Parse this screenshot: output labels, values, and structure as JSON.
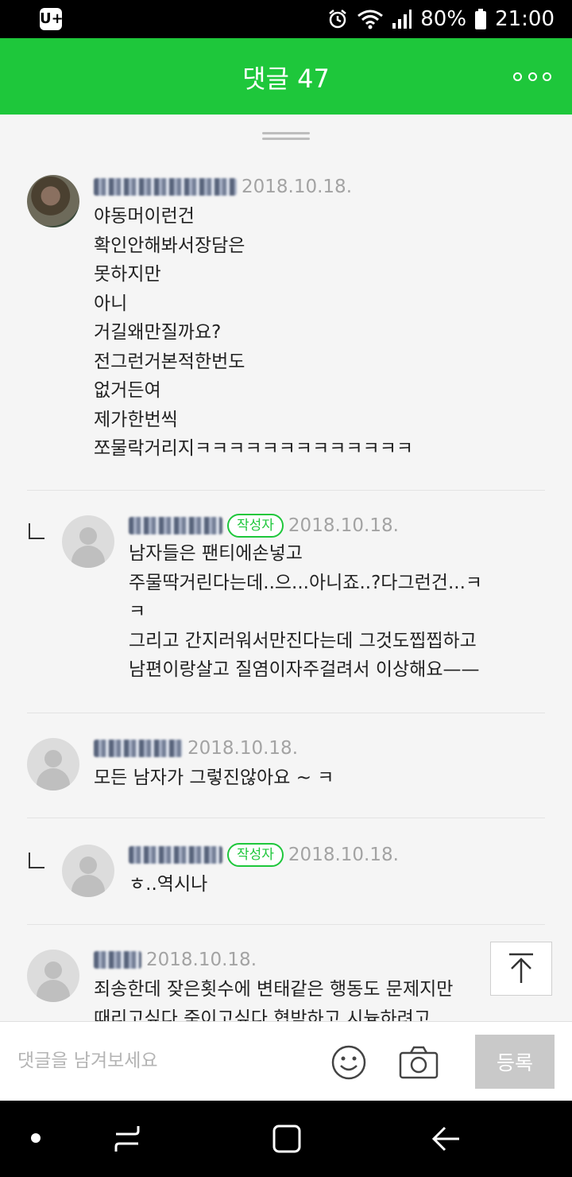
{
  "status_bar": {
    "battery": "80%",
    "time": "21:00",
    "app_icon": "U+"
  },
  "header": {
    "title": "댓글 47"
  },
  "comments": [
    {
      "avatar_type": "photo",
      "is_reply": false,
      "author_badge": "",
      "date": "2018.10.18.",
      "text": "야동머이런건\n확인안해봐서장담은\n못하지만\n아니\n거길왜만질까요?\n전그런거본적한번도\n없거든여\n제가한번씩\n쪼물락거리지ㅋㅋㅋㅋㅋㅋㅋㅋㅋㅋㅋㅋㅋ"
    },
    {
      "avatar_type": "default",
      "is_reply": true,
      "author_badge": "작성자",
      "date": "2018.10.18.",
      "text": "남자들은 팬티에손넣고\n주물딱거린다는데..으...아니죠..?다그런건...ㅋ\nㅋ\n그리고 간지러워서만진다는데 그것도찝찝하고\n남편이랑살고 질염이자주걸려서 이상해요——"
    },
    {
      "avatar_type": "default",
      "is_reply": false,
      "author_badge": "",
      "date": "2018.10.18.",
      "text": "모든 남자가 그렇진않아요 ~ ㅋ"
    },
    {
      "avatar_type": "default",
      "is_reply": true,
      "author_badge": "작성자",
      "date": "2018.10.18.",
      "text": "ㅎ..역시나"
    },
    {
      "avatar_type": "default",
      "is_reply": false,
      "author_badge": "",
      "date": "2018.10.18.",
      "text": "죄송한데 잦은횟수에 변태같은 행동도 문제지만\n때리고싶다 죽이고싶다 협박하고 시늉하려고"
    }
  ],
  "input_bar": {
    "placeholder": "댓글을 남겨보세요",
    "submit_label": "등록"
  },
  "icons": {
    "emoji": "smiley-icon",
    "camera": "camera-icon",
    "scroll_top": "arrow-up-to-top-icon",
    "more": "more-dots-icon"
  },
  "colors": {
    "accent": "#1ec73b",
    "submit_disabled": "#c9c9c9"
  }
}
